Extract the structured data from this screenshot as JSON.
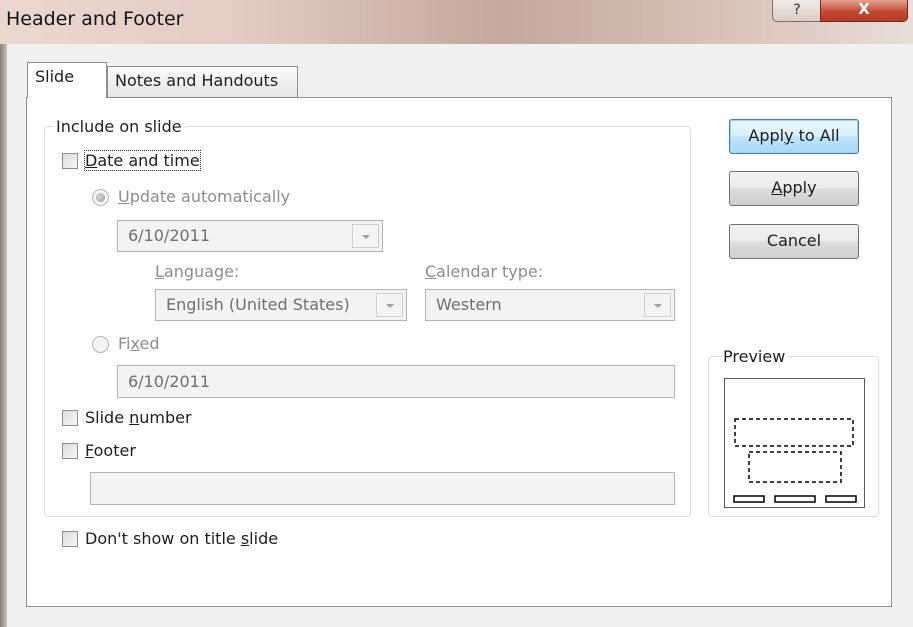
{
  "window": {
    "title": "Header and Footer",
    "help_glyph": "?",
    "close_glyph": "X"
  },
  "tabs": [
    {
      "label": "Slide",
      "selected": true
    },
    {
      "label": "Notes and Handouts",
      "selected": false
    }
  ],
  "include_group": {
    "label": "Include on slide",
    "date_time": {
      "label_prefix": "",
      "label_underlined": "D",
      "label_rest": "ate and time",
      "checked": false
    },
    "update_auto": {
      "label_underlined": "U",
      "label_rest": "pdate automatically",
      "selected": true,
      "value": "6/10/2011"
    },
    "language": {
      "label_underlined": "L",
      "label_rest": "anguage:",
      "value": "English (United States)"
    },
    "calendar": {
      "label_underlined": "C",
      "label_rest": "alendar type:",
      "value": "Western"
    },
    "fixed": {
      "label_prefix": "Fi",
      "label_underlined": "x",
      "label_rest": "ed",
      "selected": false,
      "value": "6/10/2011"
    },
    "slide_number": {
      "label_prefix": "Slide ",
      "label_underlined": "n",
      "label_rest": "umber",
      "checked": false
    },
    "footer": {
      "label_underlined": "F",
      "label_rest": "ooter",
      "checked": false,
      "value": ""
    }
  },
  "dont_show_title": {
    "label_prefix": "Don't show on title ",
    "label_underlined": "s",
    "label_rest": "lide",
    "checked": false
  },
  "buttons": {
    "apply_all": {
      "prefix": "Appl",
      "underlined": "y",
      "rest": " to All"
    },
    "apply": {
      "prefix": "",
      "underlined": "A",
      "rest": "pply"
    },
    "cancel": {
      "label": "Cancel"
    }
  },
  "preview": {
    "label": "Preview"
  }
}
